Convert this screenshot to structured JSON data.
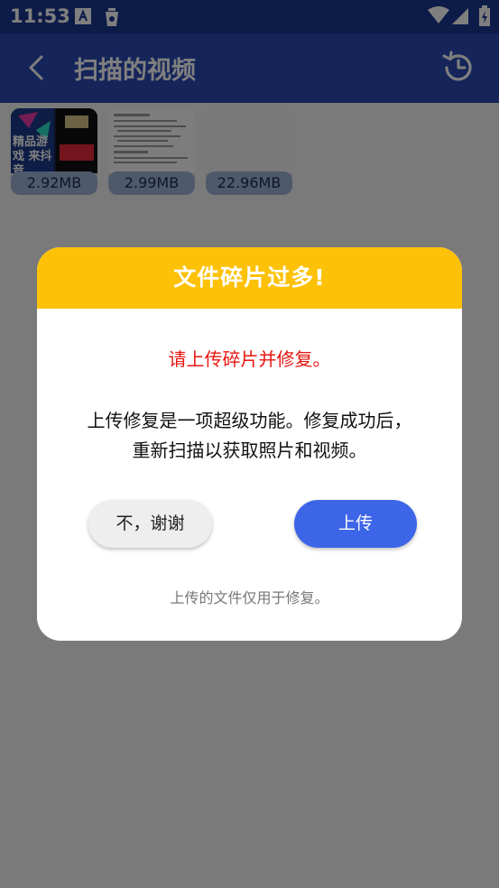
{
  "status_bar": {
    "time": "11:53"
  },
  "app_bar": {
    "title": "扫描的视频"
  },
  "videos": [
    {
      "size": "2.92MB",
      "thumb_caption": "精品游戏 来抖音"
    },
    {
      "size": "2.99MB"
    },
    {
      "size": "22.96MB"
    }
  ],
  "dialog": {
    "title": "文件碎片过多!",
    "warning": "请上传碎片并修复。",
    "body_line1": "上传修复是一项超级功能。修复成功后，",
    "body_line2": "重新扫描以获取照片和视频。",
    "cancel_label": "不，谢谢",
    "confirm_label": "上传",
    "footnote": "上传的文件仅用于修复。"
  },
  "colors": {
    "status_bar": "#1a3791",
    "app_bar": "#2a4bb5",
    "dialog_header": "#fdc108",
    "warning_text": "#e8150f",
    "primary_button": "#3d65e8"
  }
}
